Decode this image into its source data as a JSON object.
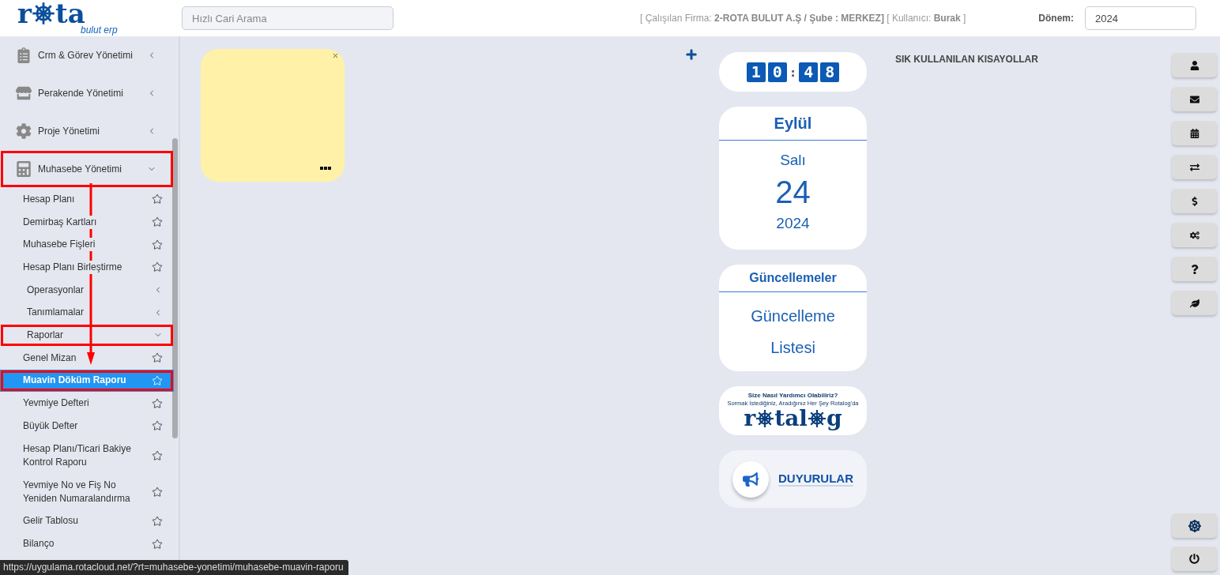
{
  "header": {
    "logo": {
      "before": "r",
      "after": "ta",
      "tagline": "bulut erp"
    },
    "search": {
      "placeholder": "Hızlı Cari Arama"
    },
    "session_info": "[ Çalışılan Firma: **2-ROTA BULUT A.Ş / Şube : MERKEZ]** [ Kullanıcı: **Burak** ]",
    "period": {
      "label": "Dönem:",
      "value": "2024"
    }
  },
  "sidebar": {
    "items": [
      {
        "label": "Crm & Görev Yönetimi",
        "kind": "module",
        "expanded": false,
        "selected": false,
        "highlighted": false
      },
      {
        "label": "Perakende Yönetimi",
        "kind": "module",
        "expanded": false,
        "selected": false,
        "highlighted": false
      },
      {
        "label": "Proje Yönetimi",
        "kind": "module",
        "expanded": false,
        "selected": false,
        "highlighted": false
      },
      {
        "label": "Muhasebe Yönetimi",
        "kind": "module",
        "expanded": true,
        "selected": false,
        "highlighted": true,
        "children": [
          {
            "label": "Hesap Planı",
            "kind": "page",
            "selected": false,
            "highlighted": false
          },
          {
            "label": "Demirbaş Kartları",
            "kind": "page",
            "selected": false,
            "highlighted": false
          },
          {
            "label": "Muhasebe Fişleri",
            "kind": "page",
            "selected": false,
            "highlighted": false
          },
          {
            "label": "Hesap Planı Birleştirme",
            "kind": "page",
            "selected": false,
            "highlighted": false
          },
          {
            "label": "Operasyonlar",
            "kind": "group",
            "expanded": false,
            "selected": false,
            "highlighted": false
          },
          {
            "label": "Tanımlamalar",
            "kind": "group",
            "expanded": false,
            "selected": false,
            "highlighted": false
          },
          {
            "label": "Raporlar",
            "kind": "group",
            "expanded": true,
            "selected": false,
            "highlighted": true,
            "children": [
              {
                "label": "Genel Mizan",
                "kind": "page",
                "selected": false,
                "highlighted": false
              },
              {
                "label": "Muavin Döküm Raporu",
                "kind": "page",
                "selected": true,
                "highlighted": true
              },
              {
                "label": "Yevmiye Defteri",
                "kind": "page",
                "selected": false,
                "highlighted": false
              },
              {
                "label": "Büyük Defter",
                "kind": "page",
                "selected": false,
                "highlighted": false
              },
              {
                "label": "Hesap Planı/Ticari Bakiye Kontrol Raporu",
                "kind": "page",
                "selected": false,
                "highlighted": false
              },
              {
                "label": "Yevmiye No ve Fiş No Yeniden Numaralandırma",
                "kind": "page",
                "selected": false,
                "highlighted": false
              },
              {
                "label": "Gelir Tablosu",
                "kind": "page",
                "selected": false,
                "highlighted": false
              },
              {
                "label": "Bilanço",
                "kind": "page",
                "selected": false,
                "highlighted": false
              }
            ]
          }
        ]
      }
    ]
  },
  "notes": [
    {
      "kind": "sticky"
    }
  ],
  "clock": {
    "hour_digits": [
      "1",
      "0"
    ],
    "separator": ":",
    "minute_digits": [
      "4",
      "8"
    ]
  },
  "calendar": {
    "month": "Eylül",
    "weekday": "Salı",
    "day": "24",
    "year": "2024"
  },
  "updates": {
    "title": "Güncellemeler",
    "link_lines": [
      "Güncelleme",
      "Listesi"
    ]
  },
  "help_banner": {
    "headline": "Size Nasıl Yardımcı Olabiliriz?",
    "subline": "Sormak İstediğiniz, Aradığınız Her Şey Rotalog'da",
    "logo_segments": [
      "r",
      "tal",
      "g"
    ]
  },
  "announcements": {
    "label": "DUYURULAR"
  },
  "shortcuts": {
    "title": "SIK KULLANILAN KISAYOLLAR"
  },
  "quick_buttons": [
    {
      "kind": "profile"
    },
    {
      "kind": "mail"
    },
    {
      "kind": "calendar"
    },
    {
      "kind": "transfer"
    },
    {
      "kind": "money"
    },
    {
      "kind": "settings"
    },
    {
      "kind": "help"
    },
    {
      "kind": "leaf"
    }
  ],
  "bottom_buttons": [
    {
      "kind": "wheel"
    },
    {
      "kind": "power"
    }
  ],
  "status_url": "https://uygulama.rotacloud.net/?rt=muhasebe-yonetimi/muhasebe-muavin-raporu"
}
